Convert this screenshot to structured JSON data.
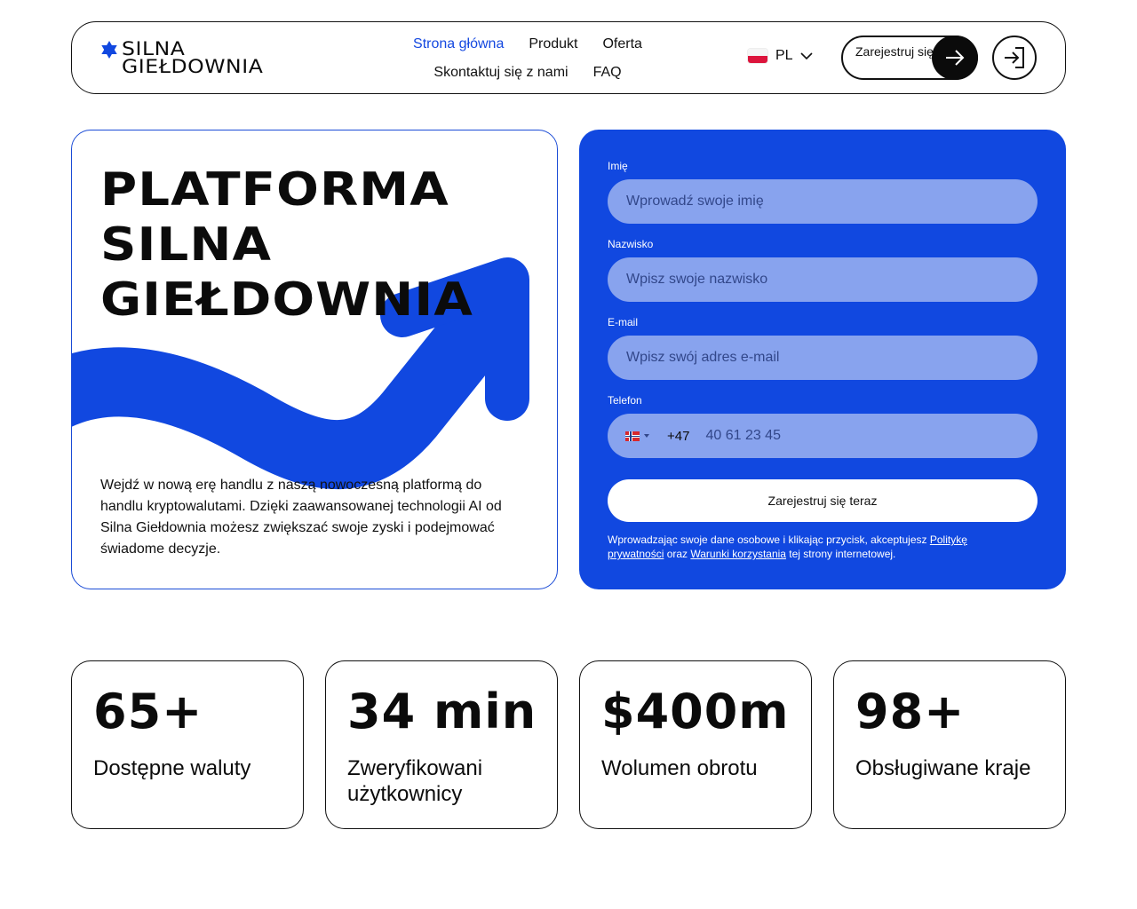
{
  "brand": {
    "name_line1": "SILNA",
    "name_line2": "GIEŁDOWNIA",
    "accent_color": "#1148e0",
    "icon": "star-of-david-icon"
  },
  "nav": {
    "row1": [
      {
        "label": "Strona główna",
        "active": true
      },
      {
        "label": "Produkt",
        "active": false
      },
      {
        "label": "Oferta",
        "active": false
      }
    ],
    "row2": [
      {
        "label": "Skontaktuj się z nami",
        "active": false
      },
      {
        "label": "FAQ",
        "active": false
      }
    ]
  },
  "language": {
    "code": "PL",
    "flag": "poland-flag-icon"
  },
  "header_actions": {
    "signup_label": "Zarejestruj się",
    "signup_icon": "arrow-right-icon",
    "login_icon": "login-icon"
  },
  "hero": {
    "title_lines": [
      "PLATFORMA",
      "SILNA",
      "GIEŁDOWNIA"
    ],
    "description": "Wejdź w nową erę handlu z naszą nowoczesną platformą do handlu kryptowalutami. Dzięki zaawansowanej technologii AI od Silna Giełdownia możesz zwiększać swoje zyski i podejmować świadome decyzje."
  },
  "form": {
    "first_name": {
      "label": "Imię",
      "placeholder": "Wprowadź swoje imię",
      "value": ""
    },
    "last_name": {
      "label": "Nazwisko",
      "placeholder": "Wpisz swoje nazwisko",
      "value": ""
    },
    "email": {
      "label": "E-mail",
      "placeholder": "Wpisz swój adres e-mail",
      "value": ""
    },
    "phone": {
      "label": "Telefon",
      "dial_code": "+47",
      "country_flag": "norway-flag-icon",
      "placeholder": "40 61 23 45",
      "value": ""
    },
    "submit_label": "Zarejestruj się teraz",
    "legal": {
      "text_before": "Wprowadzając swoje dane osobowe i klikając przycisk, akceptujesz ",
      "privacy_link": "Politykę prywatności",
      "text_middle": " oraz ",
      "terms_link": "Warunki korzystania",
      "text_after": " tej strony internetowej."
    }
  },
  "stats": [
    {
      "value": "65+",
      "label": "Dostępne waluty"
    },
    {
      "value": "34 min",
      "label": "Zweryfikowani użytkownicy"
    },
    {
      "value": "$400m",
      "label": "Wolumen obrotu"
    },
    {
      "value": "98+",
      "label": "Obsługiwane kraje"
    }
  ]
}
